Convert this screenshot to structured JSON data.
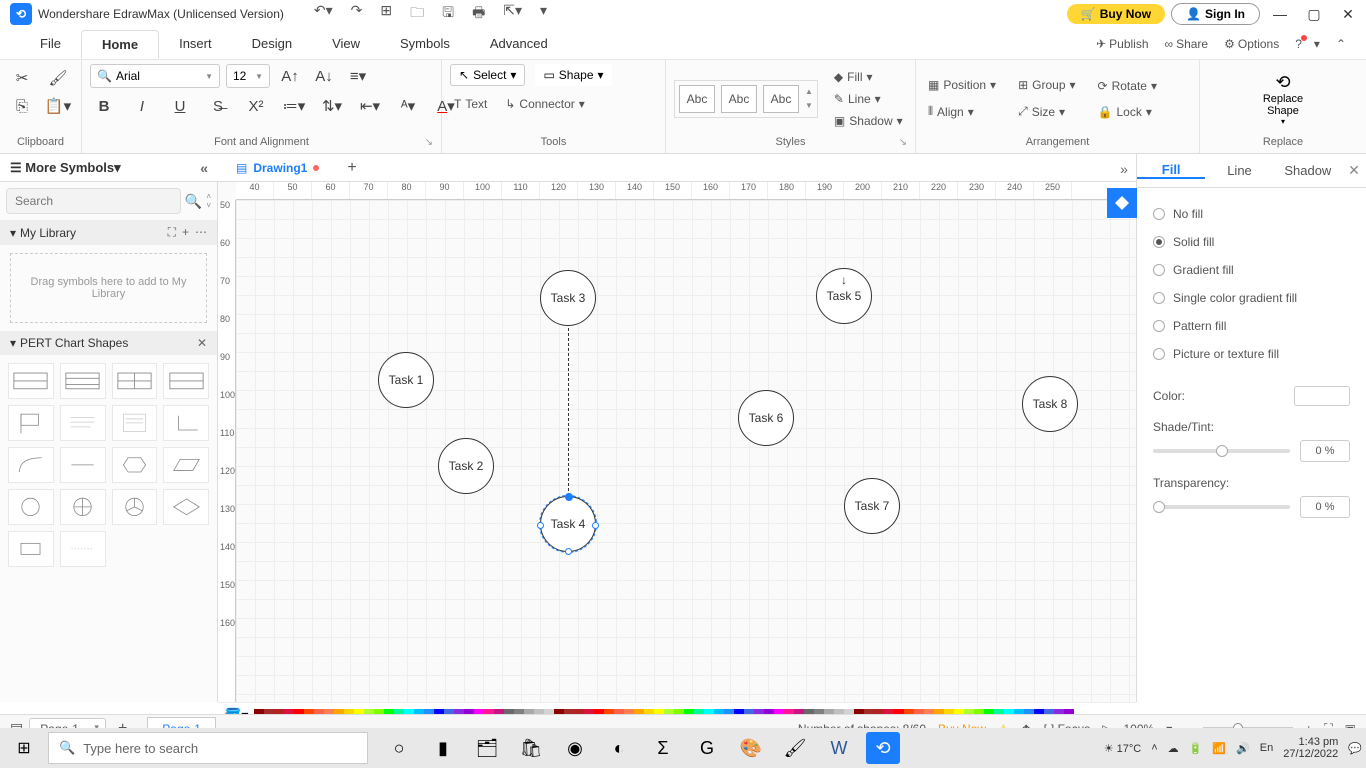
{
  "app": {
    "title": "Wondershare EdrawMax (Unlicensed Version)",
    "buy_now": "Buy Now",
    "sign_in": "Sign In"
  },
  "menu": {
    "file": "File",
    "home": "Home",
    "insert": "Insert",
    "design": "Design",
    "view": "View",
    "symbols": "Symbols",
    "advanced": "Advanced",
    "publish": "Publish",
    "share": "Share",
    "options": "Options"
  },
  "ribbon": {
    "clipboard": "Clipboard",
    "font_align": "Font and Alignment",
    "font_name": "Arial",
    "font_size": "12",
    "tools": "Tools",
    "select": "Select",
    "shape": "Shape",
    "text": "Text",
    "connector": "Connector",
    "styles": "Styles",
    "abc": "Abc",
    "fill": "Fill",
    "line": "Line",
    "shadow": "Shadow",
    "arrangement": "Arrangement",
    "position": "Position",
    "align": "Align",
    "group": "Group",
    "size": "Size",
    "rotate": "Rotate",
    "lock": "Lock",
    "replace": "Replace",
    "replace_shape": "Replace\nShape"
  },
  "tabs": {
    "drawing": "Drawing1"
  },
  "left": {
    "more_symbols": "More Symbols",
    "search_ph": "Search",
    "my_library": "My Library",
    "drop_hint": "Drag symbols here to add to My Library",
    "pert": "PERT Chart Shapes"
  },
  "canvas": {
    "rulers_h": [
      "40",
      "50",
      "60",
      "70",
      "80",
      "90",
      "100",
      "110",
      "120",
      "130",
      "140",
      "150",
      "160",
      "170",
      "180",
      "190",
      "200",
      "210",
      "220",
      "230",
      "240",
      "250"
    ],
    "rulers_v": [
      "50",
      "60",
      "70",
      "80",
      "90",
      "100",
      "110",
      "120",
      "130",
      "140",
      "150",
      "160"
    ],
    "tasks": {
      "t1": "Task 1",
      "t2": "Task 2",
      "t3": "Task 3",
      "t4": "Task 4",
      "t5": "Task 5",
      "t6": "Task 6",
      "t7": "Task 7",
      "t8": "Task 8"
    }
  },
  "right": {
    "fill_tab": "Fill",
    "line_tab": "Line",
    "shadow_tab": "Shadow",
    "no_fill": "No fill",
    "solid": "Solid fill",
    "gradient": "Gradient fill",
    "single_grad": "Single color gradient fill",
    "pattern": "Pattern fill",
    "picture": "Picture or texture fill",
    "color": "Color:",
    "shade": "Shade/Tint:",
    "transparency": "Transparency:",
    "pct0": "0 %"
  },
  "status": {
    "page_sel": "Page-1",
    "page_tab": "Page-1",
    "shapes": "Number of shapes: 8/60",
    "buy": "Buy Now",
    "focus": "Focus",
    "zoom": "100%"
  },
  "taskbar": {
    "search_ph": "Type here to search",
    "temp": "17°C",
    "time": "1:43 pm",
    "date": "27/12/2022"
  }
}
